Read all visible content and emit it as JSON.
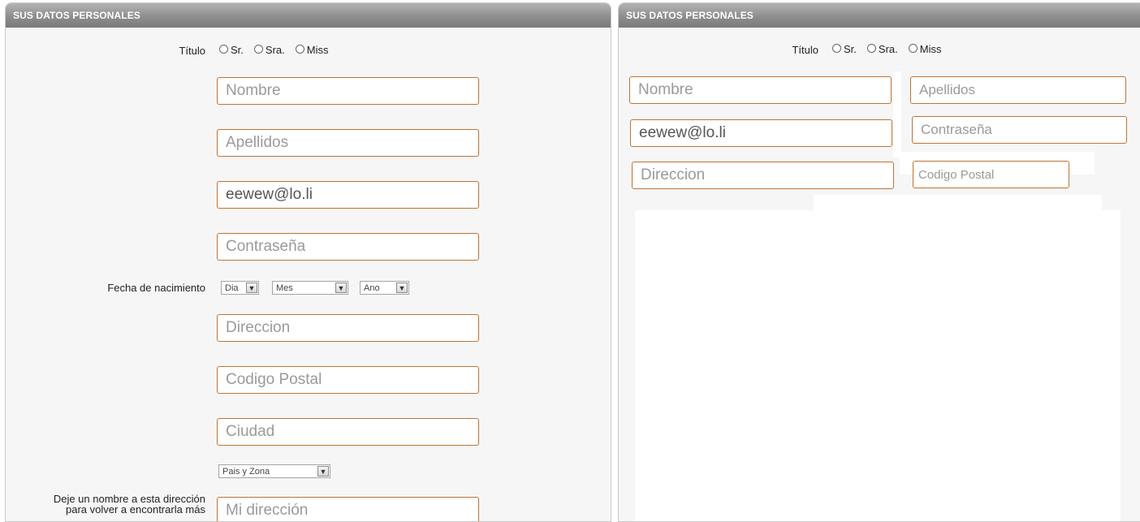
{
  "left_panel": {
    "header": "SUS DATOS PERSONALES",
    "titulo_label": "Título",
    "titulo_options": [
      "Sr.",
      "Sra.",
      "Miss"
    ],
    "nombre_placeholder": "Nombre",
    "apellidos_placeholder": "Apellidos",
    "email_value": "eewew@lo.li",
    "password_placeholder": "Contraseña",
    "birth_label": "Fecha de nacimiento",
    "day_select": "Dia",
    "month_select": "Mes",
    "year_select": "Ano",
    "direccion_placeholder": "Direccion",
    "codigo_postal_placeholder": "Codigo Postal",
    "ciudad_placeholder": "Ciudad",
    "pais_select": "Pais y Zona",
    "alias_label_line1": "Deje un nombre a esta dirección",
    "alias_label_line2": "para volver a encontrarla más",
    "alias_placeholder": "Mi dirección"
  },
  "right_panel": {
    "header": "SUS DATOS PERSONALES",
    "titulo_label": "Título",
    "titulo_options": [
      "Sr.",
      "Sra.",
      "Miss"
    ],
    "nombre_placeholder": "Nombre",
    "apellidos_placeholder": "Apellidos",
    "email_value": "eewew@lo.li",
    "password_placeholder": "Contraseña",
    "direccion_placeholder": "Direccion",
    "codigo_postal_placeholder": "Codigo Postal"
  },
  "colors": {
    "field_border": "#c07434",
    "panel_bg": "#f6f6f6",
    "header_gradient_top": "#b4b4b4",
    "header_gradient_bottom": "#7a7a7a"
  }
}
